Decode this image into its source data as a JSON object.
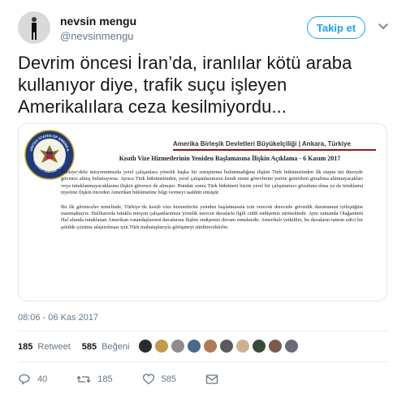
{
  "user": {
    "display_name": "nevsin mengu",
    "handle": "@nevsinmengu",
    "follow_label": "Takip et"
  },
  "tweet": {
    "text": "Devrim öncesi İran’da, iranlılar kötü araba kullanıyor diye, trafik suçu işleyen Amerikalılara ceza kesilmiyordu...",
    "timestamp": "08:06 - 06 Kas 2017"
  },
  "document": {
    "seal_text_top": "UNITED STATES OF AMERICA",
    "seal_text_bottom": "EMBASSY ANKARA TURKEY",
    "header": "Amerika Birleşik Devletleri Büyükelçiliği | Ankara, Türkiye",
    "title": "Kısıtlı Vize Hizmetlerinin Yeniden Başlamasına İlişkin Açıklama - 6 Kasım 2017",
    "paragraph1": "Türkiye’deki misyonumuzda yerel çalışanlara yönelik başka bir soruşturma bulunmadığına ilişkin Türk hükümetinden ilk etapta üst düzeyde güvence almış bulunuyoruz. Ayrıca Türk hükümetinden, yerel çalışanlarımızın kendi resmi görevlerini yerine getirirken gözaltına alınmayacakları veya tutuklanmayacaklarına ilişkin güvence de almıştır. Bundan sonra Türk hükümeti bizim yerel bir çalışanımızı gözaltına alma ya da tutuklama niyetine ilişkin önceden Amerikan hükümetine bilgi vermeyi taahhüt etmiştir.",
    "paragraph2": "Bu ilk güvenceler temelinde, Türkiye’de kısıtlı vize hizmetlerini yeniden başlatmasına izin verecek derecede güvenlik durumunun iyileştiğine inanmaktayız. Halihazırda tutuklu misyon çalışanlarımıza yönelik mevcut davalarla ilgili ciddi endişemiz sürmektedir. Aynı zamanda Olağanüstü Hal altında tutuklanan Amerikan vatandaşlarının davalarına ilişkin endişemiz devam etmektedir. Amerikalı yetkililer, bu davaların tatmin edici bir şekilde çözüme ulaştırılması için Türk muhataplarıyla görüşmeyi sürdürecektirler."
  },
  "stats": {
    "retweet_count": "185",
    "retweet_label": "Retweet",
    "like_count": "585",
    "like_label": "Beğeni"
  },
  "actions": {
    "reply_count": "40",
    "retweet_count": "185",
    "like_count": "585"
  },
  "colors": {
    "accent": "#1da1f2",
    "text": "#14171a",
    "muted": "#657786",
    "divider": "#e6ecf0",
    "seal_navy": "#1f3a78",
    "header_rule": "#8b1a1a"
  },
  "icons": [
    "chevron-down-icon",
    "reply-icon",
    "retweet-icon",
    "heart-icon",
    "mail-icon"
  ]
}
